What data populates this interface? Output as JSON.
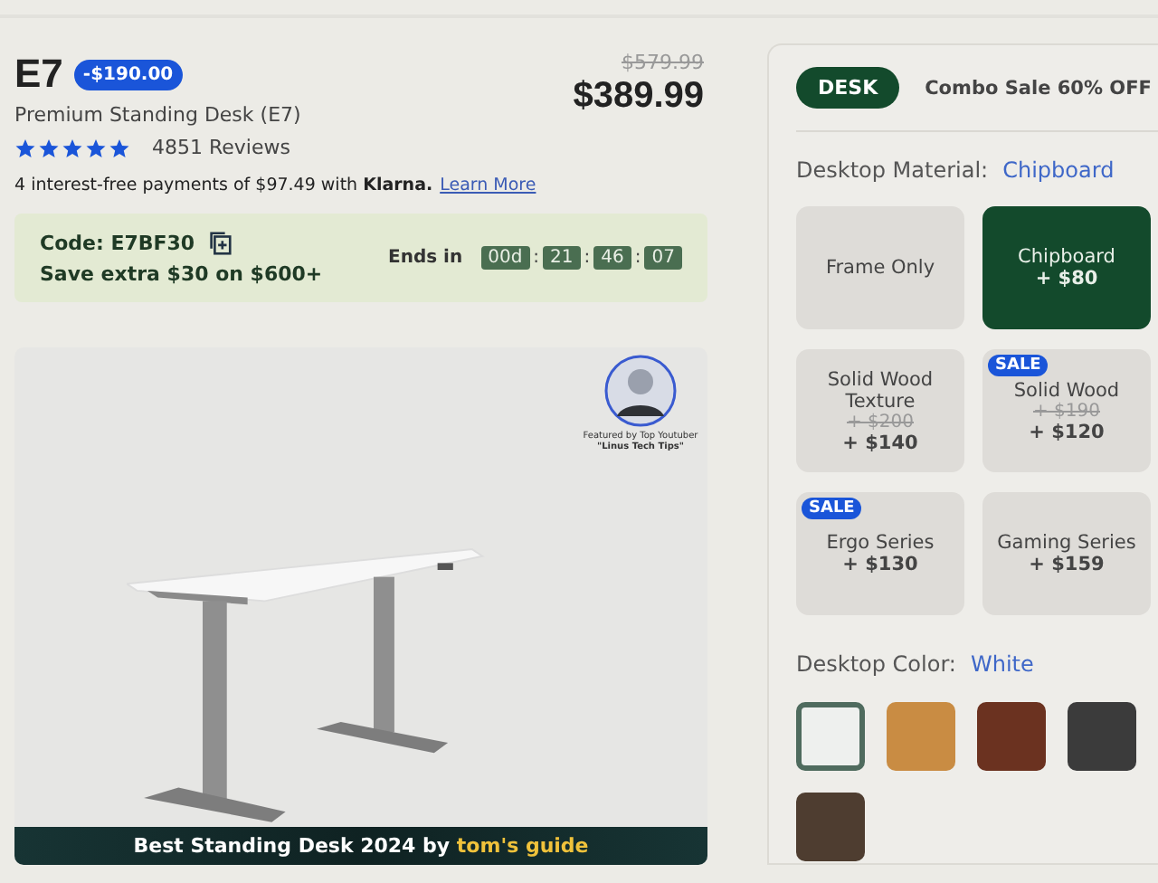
{
  "product": {
    "model": "E7",
    "discount_badge": "-$190.00",
    "name": "Premium Standing Desk (E7)",
    "old_price": "$579.99",
    "price": "$389.99",
    "stars": 5,
    "reviews": "4851 Reviews",
    "installments": "4 interest-free payments of $97.49 with **Klarna.**",
    "learn_more": "Learn More"
  },
  "promo": {
    "code": "Code: E7BF30",
    "offer": "Save extra $30 on $600+",
    "ends_label": "Ends in",
    "separator": ":",
    "countdown": [
      "00d",
      "21",
      "46",
      "07"
    ]
  },
  "gallery": {
    "featured_line1": "Featured by Top Youtuber",
    "featured_line2": "\"Linus Tech Tips\"",
    "caption": "Best Standing Desk 2024 by",
    "caption_highlight": "tom's guide"
  },
  "options": {
    "tag": "DESK",
    "tag_text": "Combo Sale 60% OFF",
    "material_label": "Desktop Material:",
    "material_value": "Chipboard",
    "materials": [
      {
        "name": "Frame Only",
        "selected": false,
        "sale": false
      },
      {
        "name": "Chipboard",
        "price": "+ $80",
        "selected": true,
        "sale": false
      },
      {
        "name": "Solid Wood Texture",
        "old_price": "+ $200",
        "price": "+ $140",
        "selected": false,
        "sale": false
      },
      {
        "name": "Solid Wood",
        "old_price": "+ $190",
        "price": "+ $120",
        "selected": false,
        "sale": true,
        "sale_label": "SALE"
      },
      {
        "name": "Ergo Series",
        "price": "+ $130",
        "selected": false,
        "sale": true,
        "sale_label": "SALE"
      },
      {
        "name": "Gaming Series",
        "price": "+ $159",
        "selected": false,
        "sale": false
      }
    ],
    "color_label": "Desktop Color:",
    "color_value": "White",
    "colors": [
      {
        "color": "#eef0ee",
        "selected": true
      },
      {
        "color": "#c98c43",
        "selected": false
      },
      {
        "color": "#6b3220",
        "selected": false
      },
      {
        "color": "#3b3b3b",
        "selected": false
      },
      {
        "color": "#4e3d30",
        "selected": false
      }
    ]
  }
}
